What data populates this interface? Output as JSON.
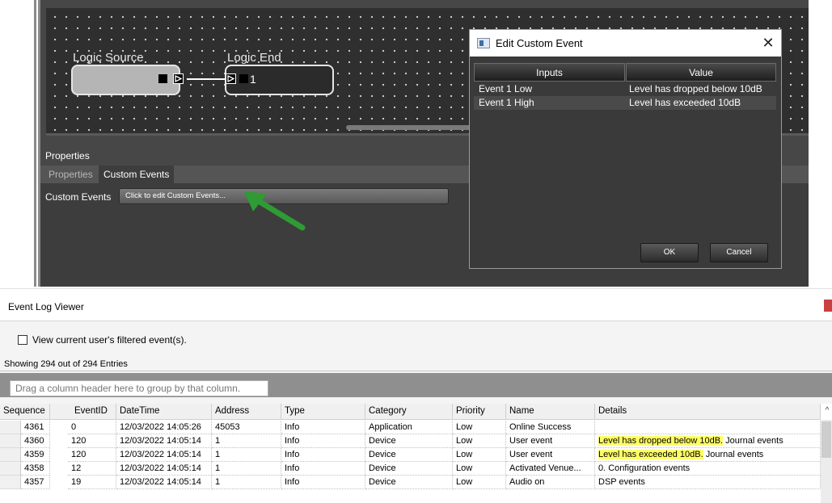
{
  "editor": {
    "nodes": [
      {
        "label": "Logic Source"
      },
      {
        "label": "Logic End",
        "port_number": "1"
      }
    ],
    "properties": {
      "header": "Properties",
      "tabs": [
        "Properties",
        "Custom Events"
      ],
      "active_tab": "Custom Events",
      "custom_events_label": "Custom Events",
      "custom_events_button": "Click to edit Custom Events..."
    },
    "annotation_arrow_color": "#2e9b33"
  },
  "dialog": {
    "title": "Edit Custom Event",
    "close_glyph": "✕",
    "columns": [
      "Inputs",
      "Value"
    ],
    "rows": [
      {
        "input": "Event 1 Low",
        "value": "Level has dropped below 10dB"
      },
      {
        "input": "Event 1 High",
        "value": "Level has exceeded 10dB"
      }
    ],
    "ok_label": "OK",
    "cancel_label": "Cancel"
  },
  "event_log": {
    "title": "Event Log Viewer",
    "filter_label": "View current user's filtered event(s).",
    "filter_checked": false,
    "entries_text": "Showing 294 out of 294 Entries",
    "groupby_placeholder": "Drag a column header here to group by that column.",
    "columns": [
      "Sequence",
      "EventID",
      "DateTime",
      "Address",
      "Type",
      "Category",
      "Priority",
      "Name",
      "Details"
    ],
    "rows": [
      {
        "sequence": "4361",
        "event_id": "0",
        "datetime": "12/03/2022 14:05:26",
        "address": "45053",
        "type": "Info",
        "category": "Application",
        "priority": "Low",
        "name": "Online Success",
        "details_hl": "",
        "details": ""
      },
      {
        "sequence": "4360",
        "event_id": "120",
        "datetime": "12/03/2022 14:05:14",
        "address": "1",
        "type": "Info",
        "category": "Device",
        "priority": "Low",
        "name": "User event",
        "details_hl": "Level has dropped below 10dB.",
        "details": " Journal events"
      },
      {
        "sequence": "4359",
        "event_id": "120",
        "datetime": "12/03/2022 14:05:14",
        "address": "1",
        "type": "Info",
        "category": "Device",
        "priority": "Low",
        "name": "User event",
        "details_hl": "Level has exceeded 10dB.",
        "details": " Journal events"
      },
      {
        "sequence": "4358",
        "event_id": "12",
        "datetime": "12/03/2022 14:05:14",
        "address": "1",
        "type": "Info",
        "category": "Device",
        "priority": "Low",
        "name": "Activated Venue...",
        "details_hl": "",
        "details": "0. Configuration events"
      },
      {
        "sequence": "4357",
        "event_id": "19",
        "datetime": "12/03/2022 14:05:14",
        "address": "1",
        "type": "Info",
        "category": "Device",
        "priority": "Low",
        "name": "Audio on",
        "details_hl": "",
        "details": "DSP events"
      }
    ],
    "highlight_color": "#ffff66"
  }
}
